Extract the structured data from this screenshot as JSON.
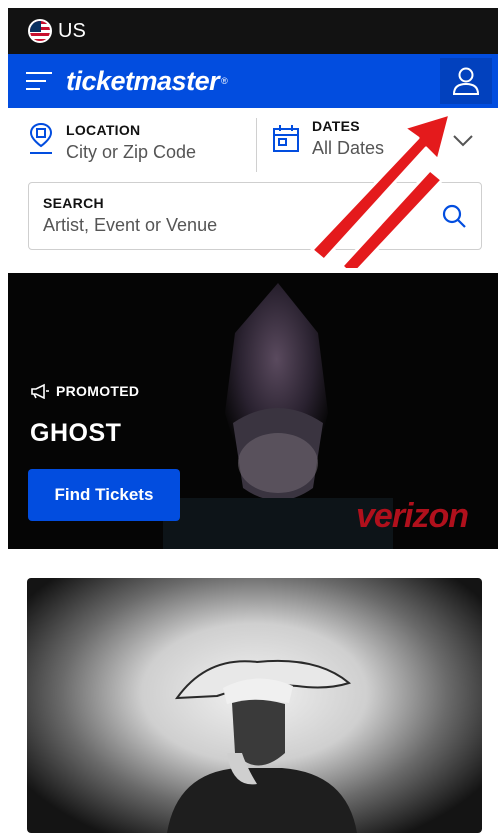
{
  "topbar": {
    "region_label": "US"
  },
  "navbar": {
    "brand": "ticketmaster",
    "brand_mark": "®"
  },
  "filters": {
    "location": {
      "label": "LOCATION",
      "placeholder": "City or Zip Code"
    },
    "dates": {
      "label": "DATES",
      "value": "All Dates"
    }
  },
  "search": {
    "label": "SEARCH",
    "placeholder": "Artist, Event or Venue"
  },
  "hero": {
    "promo_label": "PROMOTED",
    "title": "GHOST",
    "cta_label": "Find Tickets",
    "sponsor": "verizon"
  },
  "colors": {
    "brand_blue": "#024ddf",
    "topbar": "#121212",
    "annotation_arrow": "#e41a1c",
    "sponsor_red": "#b0101c"
  }
}
